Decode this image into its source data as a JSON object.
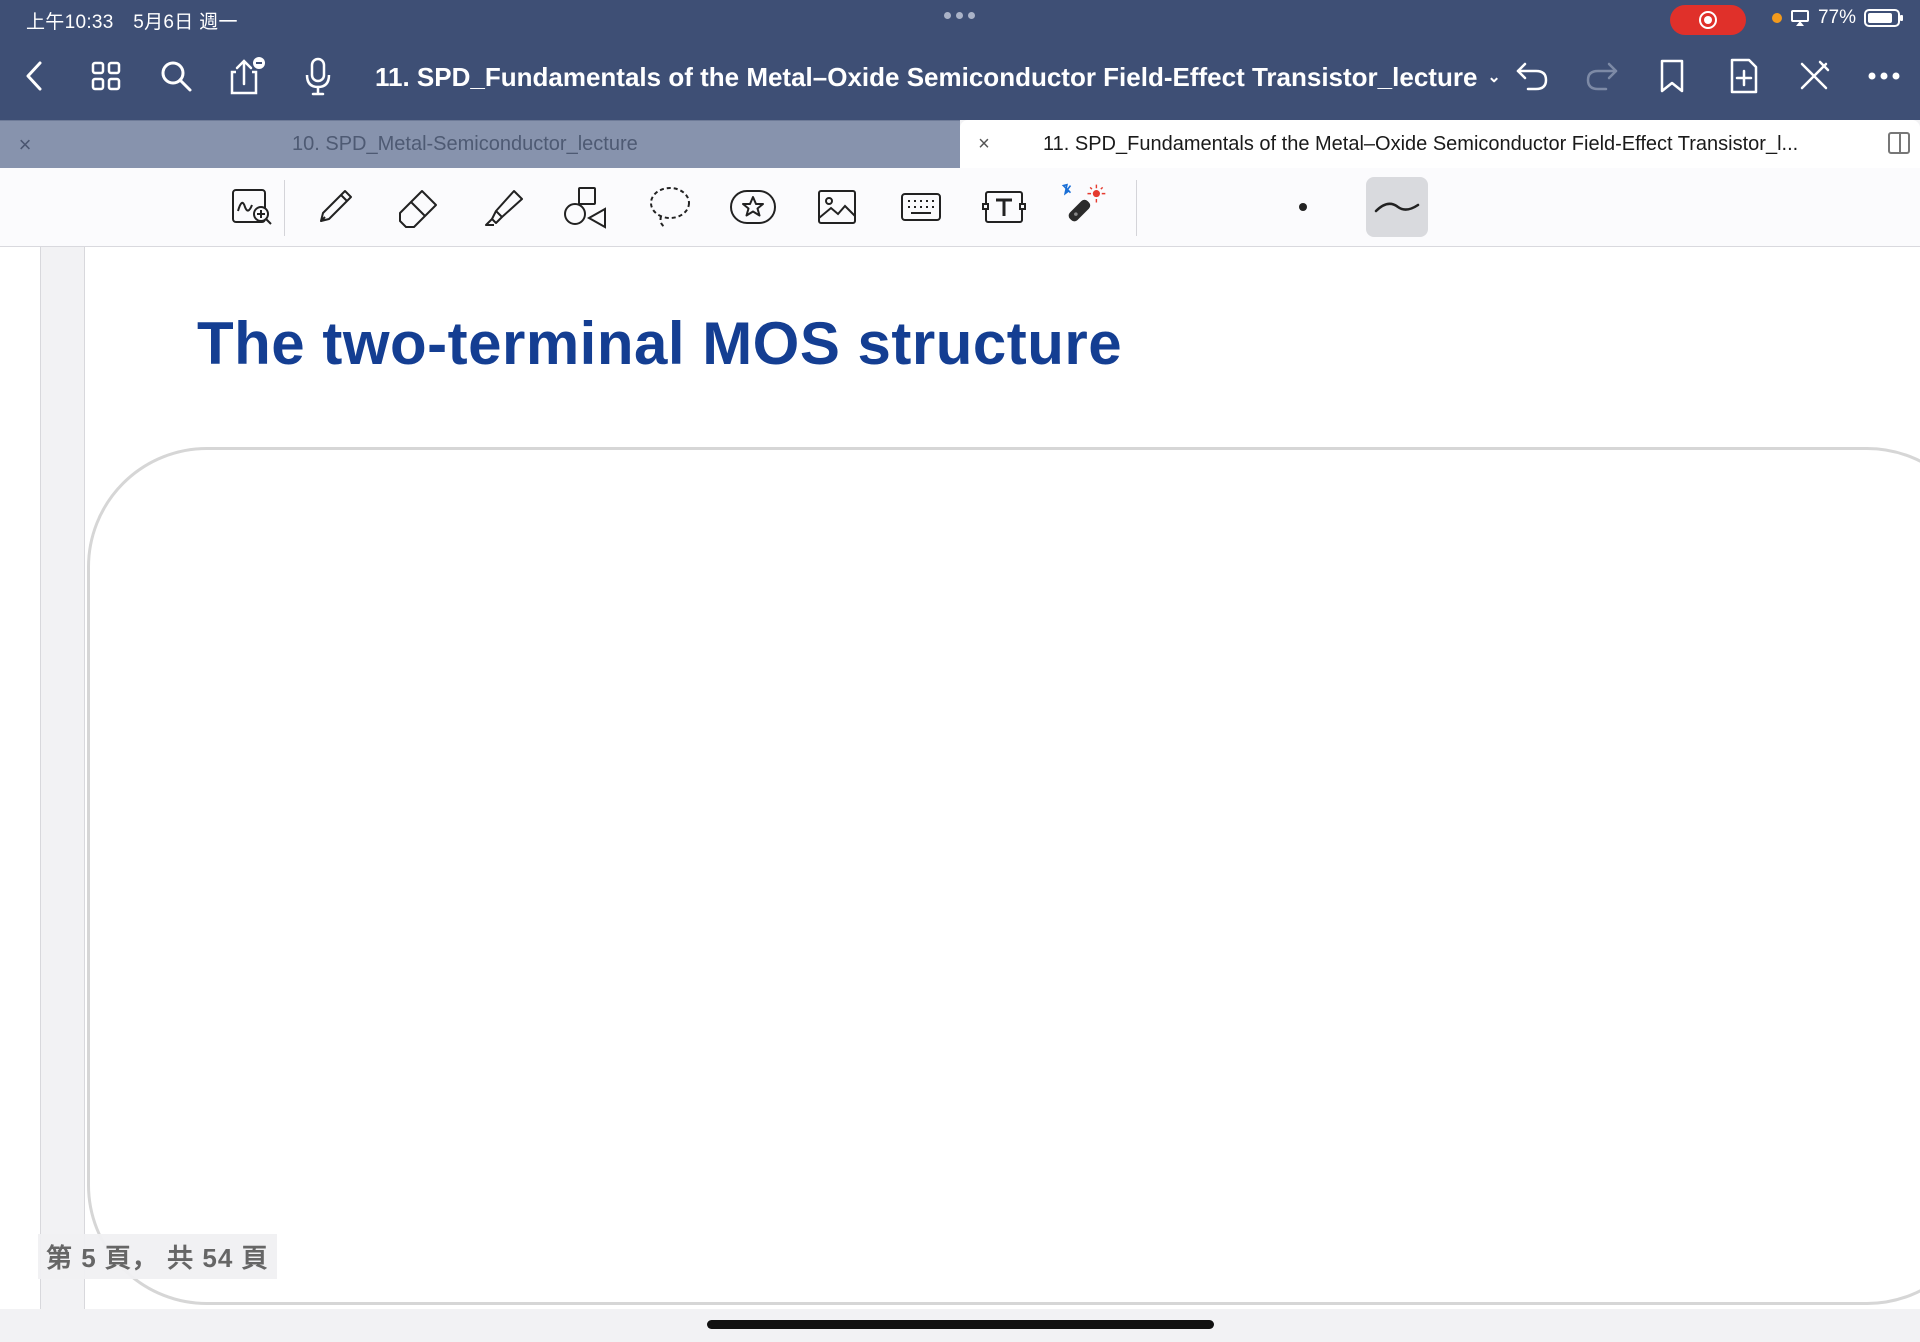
{
  "status_bar": {
    "time": "上午10:33",
    "date": "5月6日 週一",
    "battery": "77%"
  },
  "nav": {
    "document_title": "11. SPD_Fundamentals of the Metal–Oxide Semiconductor Field-Effect Transistor_lecture",
    "chevron": "⌄"
  },
  "tabs": [
    {
      "close": "×",
      "label": "10. SPD_Metal-Semiconductor_lecture"
    },
    {
      "close": "×",
      "label": "11. SPD_Fundamentals of the Metal–Oxide Semiconductor Field-Effect Transistor_l..."
    }
  ],
  "slide": {
    "title": "The two-terminal MOS structure"
  },
  "page_indicator": "第 5 頁， 共 54 頁",
  "colors": {
    "nav_bar": "#3e4f75",
    "slide_title": "#143e92",
    "record": "#e0302a"
  }
}
